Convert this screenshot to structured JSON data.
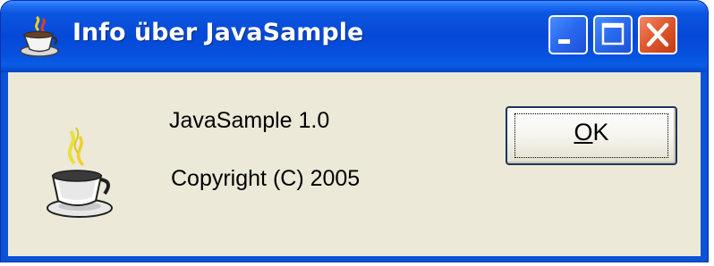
{
  "window": {
    "title": "Info über JavaSample",
    "icon": "java-cup-icon",
    "controls": {
      "minimize": "minimize-icon",
      "maximize": "maximize-icon",
      "close": "close-icon"
    },
    "colors": {
      "titlebar": "#0a52d6",
      "client": "#ece9d8",
      "close": "#e05a30"
    }
  },
  "dialog": {
    "icon": "java-coffee-cup-icon",
    "version_text": "JavaSample 1.0",
    "copyright_text": "Copyright (C) 2005",
    "ok_button": {
      "accelerator": "O",
      "rest": "K"
    }
  }
}
